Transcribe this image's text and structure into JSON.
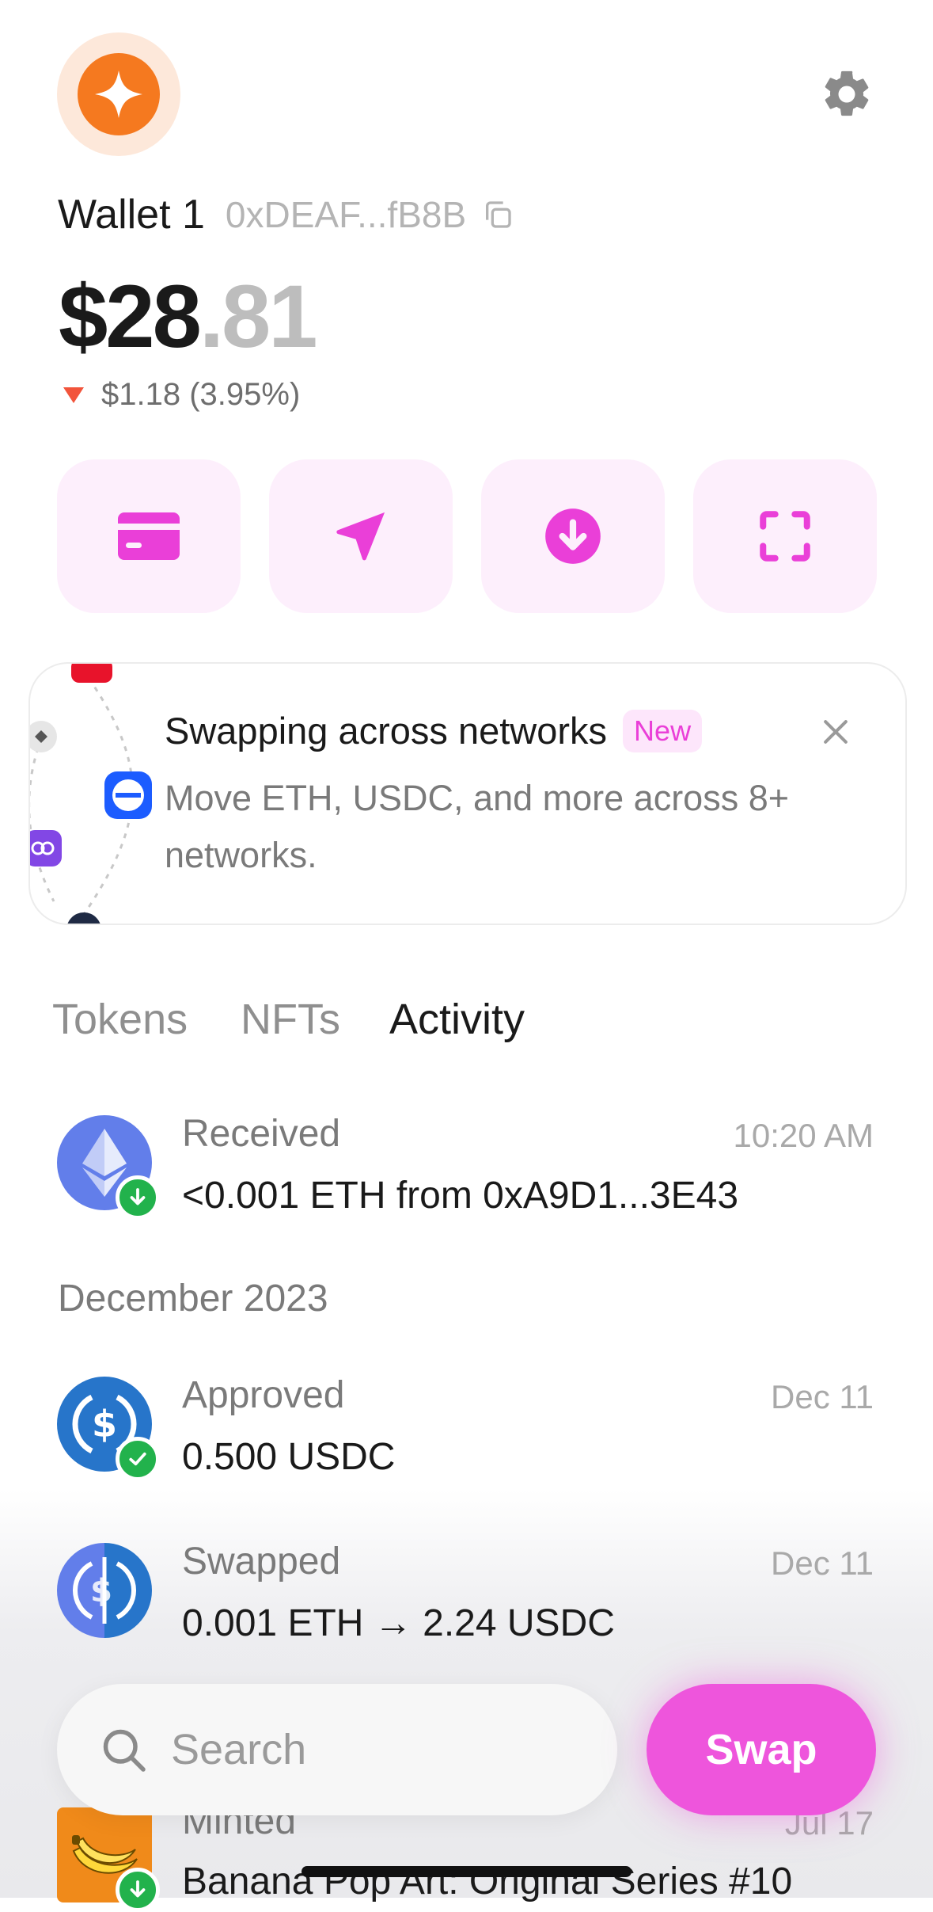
{
  "header": {
    "wallet_name": "Wallet 1",
    "wallet_address": "0xDEAF...fB8B",
    "avatar_color": "#f5791f",
    "settings_icon": "gear-icon"
  },
  "balance": {
    "dollars": "$28",
    "cents": ".81",
    "change": "$1.18 (3.95%)",
    "change_direction": "down",
    "change_color": "#f2543b"
  },
  "actions": [
    {
      "id": "buy",
      "icon": "card-icon"
    },
    {
      "id": "send",
      "icon": "send-icon"
    },
    {
      "id": "receive",
      "icon": "receive-icon"
    },
    {
      "id": "scan",
      "icon": "scan-icon"
    }
  ],
  "promo": {
    "title": "Swapping across networks",
    "badge": "New",
    "body": "Move ETH, USDC, and more across 8+ networks."
  },
  "tabs": [
    {
      "label": "Tokens",
      "active": false
    },
    {
      "label": "NFTs",
      "active": false
    },
    {
      "label": "Activity",
      "active": true
    }
  ],
  "activity": {
    "recent": {
      "title": "Received",
      "subtitle": "<0.001 ETH from 0xA9D1...3E43",
      "time": "10:20 AM",
      "icon": "eth-icon"
    },
    "section_header": "December 2023",
    "items": [
      {
        "title": "Approved",
        "subtitle": "0.500 USDC",
        "time": "Dec 11",
        "icon": "usdc-icon"
      },
      {
        "title": "Swapped",
        "subtitle": "0.001 ETH → 2.24 USDC",
        "time": "Dec 11",
        "icon": "swap-pair-icon"
      },
      {
        "title": "Minted",
        "subtitle": "Banana Pop Art: Original Series #10",
        "time": "Jul 17",
        "icon": "banana-nft-icon"
      }
    ]
  },
  "search": {
    "placeholder": "Search"
  },
  "swap_button": {
    "label": "Swap",
    "color": "#ee55dc"
  },
  "colors": {
    "accent_pink": "#ee55dc",
    "action_bg": "#fdeffc",
    "eth_purple": "#627eea",
    "usdc_blue": "#2775ca",
    "success_green": "#22b24c"
  }
}
